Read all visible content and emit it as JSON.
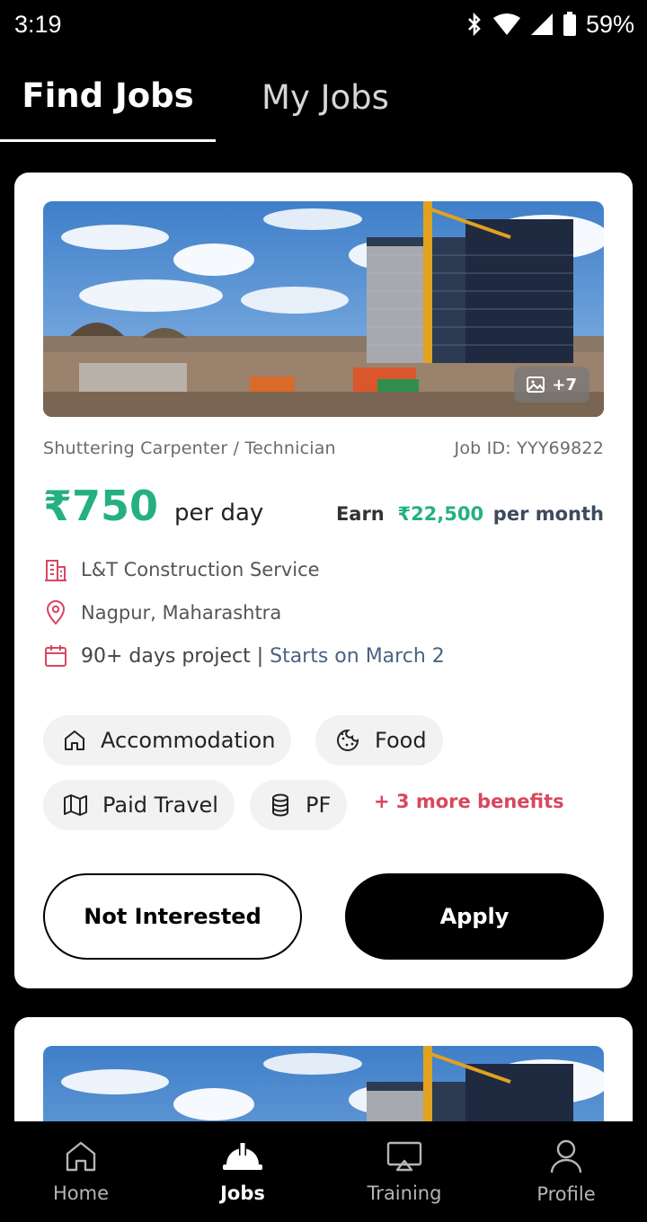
{
  "status_bar": {
    "time": "3:19",
    "battery": "59%"
  },
  "tabs": [
    {
      "label": "Find Jobs",
      "active": true
    },
    {
      "label": "My Jobs",
      "active": false
    }
  ],
  "job": {
    "photo_more": "+7",
    "title": "Shuttering Carpenter / Technician",
    "job_id": "Job ID: YYY69822",
    "price": "₹750",
    "price_unit": "per day",
    "earn_label": "Earn",
    "earn_amount": "₹22,500",
    "earn_unit": "per month",
    "company": "L&T Construction Service",
    "location": "Nagpur, Maharashtra",
    "duration": "90+ days project |",
    "start": "Starts on March 2",
    "benefits": [
      "Accommodation",
      "Food",
      "Paid Travel",
      "PF"
    ],
    "more_benefits": "+ 3 more benefits",
    "not_interested_label": "Not Interested",
    "apply_label": "Apply"
  },
  "bottom_nav": [
    {
      "label": "Home",
      "icon": "home-icon",
      "active": false
    },
    {
      "label": "Jobs",
      "icon": "hard-hat-icon",
      "active": true
    },
    {
      "label": "Training",
      "icon": "presentation-icon",
      "active": false
    },
    {
      "label": "Profile",
      "icon": "user-icon",
      "active": false
    }
  ],
  "colors": {
    "accent_green": "#25b07f",
    "benefit_red": "#d8475e",
    "icon_red": "#d8475e",
    "start_blue": "#4a6380"
  }
}
